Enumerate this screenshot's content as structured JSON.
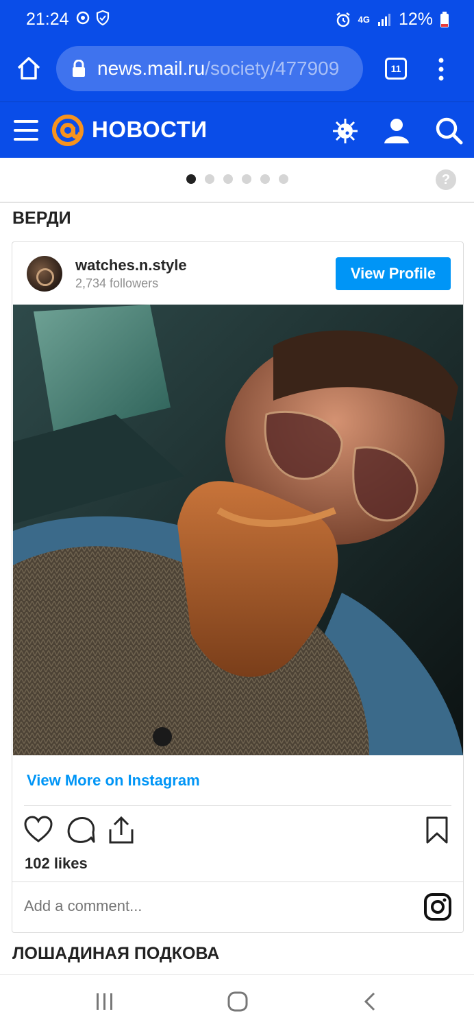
{
  "status_bar": {
    "time": "21:24",
    "network": "4G",
    "battery": "12%"
  },
  "browser": {
    "url_domain": "news.mail.ru",
    "url_path": "/society/477909",
    "tab_count": "11"
  },
  "news_header": {
    "brand": "НОВОСТИ"
  },
  "carousel": {
    "active_index": 0,
    "total": 6,
    "help_label": "?"
  },
  "sections": {
    "first_title": "ВЕРДИ",
    "second_title": "ЛОШАДИНАЯ ПОДКОВА"
  },
  "instagram_embed": {
    "username": "watches.n.style",
    "followers": "2,734 followers",
    "view_profile": "View Profile",
    "view_more": "View More on Instagram",
    "likes": "102 likes",
    "comment_placeholder": "Add a comment..."
  },
  "colors": {
    "brand_blue": "#0a4de8",
    "instagram_blue": "#0095f6",
    "logo_orange": "#f7931e"
  }
}
